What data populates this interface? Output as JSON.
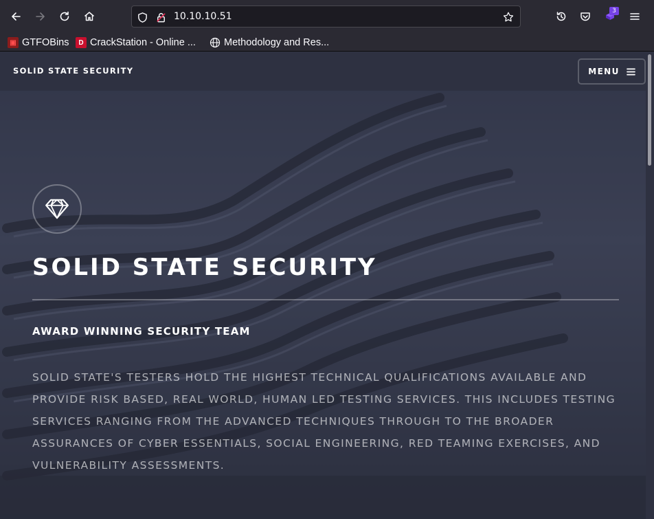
{
  "browser": {
    "url": "10.10.10.51",
    "extension_badge": "3",
    "bookmarks": [
      {
        "label": "GTFOBins",
        "icon": "gtfobins-icon"
      },
      {
        "label": "CrackStation - Online ...",
        "icon": "crackstation-icon"
      },
      {
        "label": "Methodology and Res...",
        "icon": "globe-icon"
      }
    ]
  },
  "site": {
    "header_title": "SOLID STATE SECURITY",
    "menu_label": "MENU",
    "banner_title": "SOLID STATE SECURITY",
    "banner_subtitle": "AWARD WINNING SECURITY TEAM",
    "banner_text": "Solid State's testers hold the highest technical qualifications available and provide risk based, real world, human led testing services. This includes testing services ranging from the advanced techniques through to the broader assurances of Cyber Essentials, Social Engineering, Red Teaming Exercises, and Vulnerability Assessments."
  },
  "colors": {
    "chrome": "#2b2a33",
    "page_bg": "#2e3141",
    "accent_purple": "#7542e5"
  }
}
